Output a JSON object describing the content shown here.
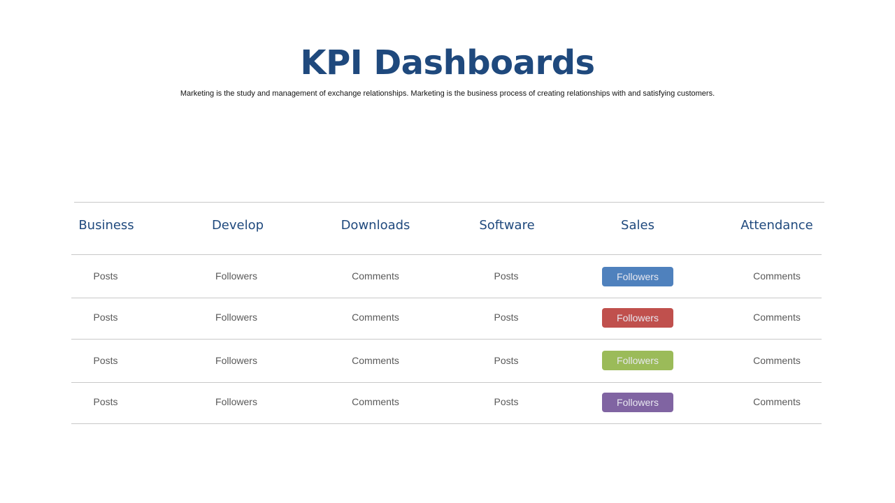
{
  "title": "KPI Dashboards",
  "subtitle": "Marketing is the study and management of exchange relationships. Marketing is the  business process of creating relationships with and satisfying customers.",
  "table": {
    "headers": [
      "Business",
      "Develop",
      "Downloads",
      "Software",
      "Sales",
      "Attendance"
    ],
    "rows": [
      {
        "cells": [
          "Posts",
          "Followers",
          "Comments",
          "Posts",
          "Followers",
          "Comments"
        ],
        "badge_color": "#4f81bd"
      },
      {
        "cells": [
          "Posts",
          "Followers",
          "Comments",
          "Posts",
          "Followers",
          "Comments"
        ],
        "badge_color": "#c0504d"
      },
      {
        "cells": [
          "Posts",
          "Followers",
          "Comments",
          "Posts",
          "Followers",
          "Comments"
        ],
        "badge_color": "#9bbb59"
      },
      {
        "cells": [
          "Posts",
          "Followers",
          "Comments",
          "Posts",
          "Followers",
          "Comments"
        ],
        "badge_color": "#8064a2"
      }
    ]
  }
}
